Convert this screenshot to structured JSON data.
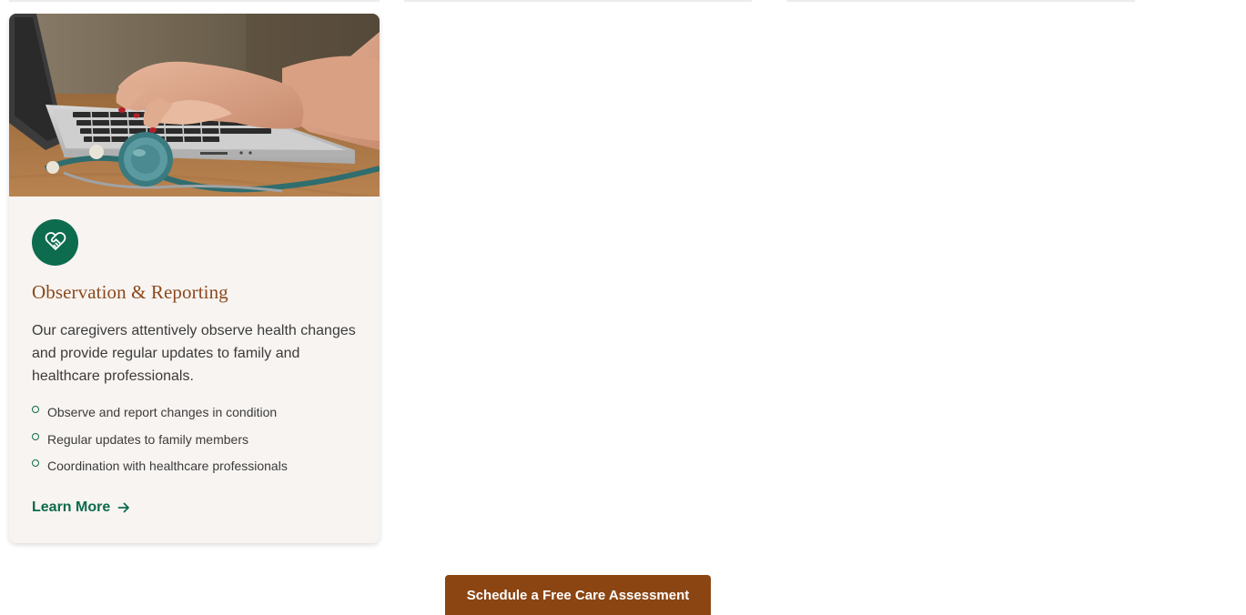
{
  "service_card": {
    "image_alt": "Hands typing on a laptop with a stethoscope on the desk",
    "icon": "heart-handshake-icon",
    "title": "Observation & Reporting",
    "description": "Our caregivers attentively observe health changes and provide regular updates to family and healthcare professionals.",
    "features": [
      "Observe and report changes in condition",
      "Regular updates to family members",
      "Coordination with healthcare professionals"
    ],
    "link_label": "Learn More",
    "link_icon": "arrow-right-icon"
  },
  "cta": {
    "label": "Schedule a Free Care Assessment"
  },
  "colors": {
    "brand_green": "#0d6b4e",
    "brand_brown": "#8b4513",
    "title_brown": "#8b4a1e",
    "card_background": "#f8f4f1"
  }
}
